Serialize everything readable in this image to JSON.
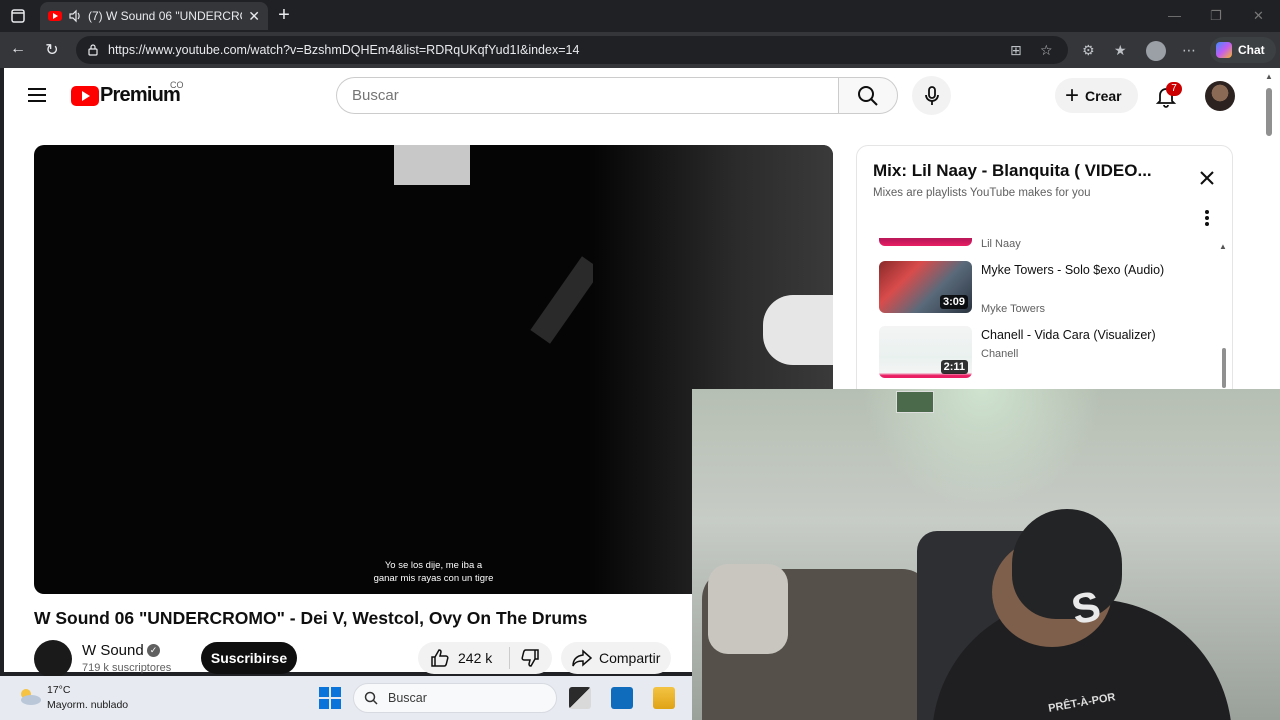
{
  "browser": {
    "tab_title": "(7) W Sound 06 \"UNDERCRO",
    "url": "https://www.youtube.com/watch?v=BzshmDQHEm4&list=RDRqUKqfYud1I&index=14",
    "chat_label": "Chat"
  },
  "youtube": {
    "brand": "Premium",
    "country": "CO",
    "search_placeholder": "Buscar",
    "create_label": "Crear",
    "notification_count": "7"
  },
  "video": {
    "subtitle_line1": "Yo se los dije, me iba a",
    "subtitle_line2": "ganar mis rayas con un tigre",
    "title": "W Sound 06 \"UNDERCROMO\" - Dei V, Westcol, Ovy On The Drums",
    "channel": "W Sound",
    "subscribers": "719 k suscriptores",
    "subscribe_label": "Suscribirse",
    "likes": "242 k",
    "share_label": "Compartir"
  },
  "playlist": {
    "title": "Mix: Lil Naay - Blanquita ( VIDEO...",
    "subtitle": "Mixes are playlists YouTube makes for you",
    "items": [
      {
        "title": "",
        "artist": "Lil Naay",
        "duration": ""
      },
      {
        "title": "Myke Towers - Solo $exo (Audio)",
        "artist": "Myke Towers",
        "duration": "3:09"
      },
      {
        "title": "Chanell - Vida Cara (Visualizer)",
        "artist": "Chanell",
        "duration": "2:11"
      }
    ]
  },
  "webcam": {
    "shirt_text": "PRÊT-À-POR"
  },
  "taskbar": {
    "temperature": "17°C",
    "weather": "Mayorm. nublado",
    "search_label": "Buscar"
  }
}
